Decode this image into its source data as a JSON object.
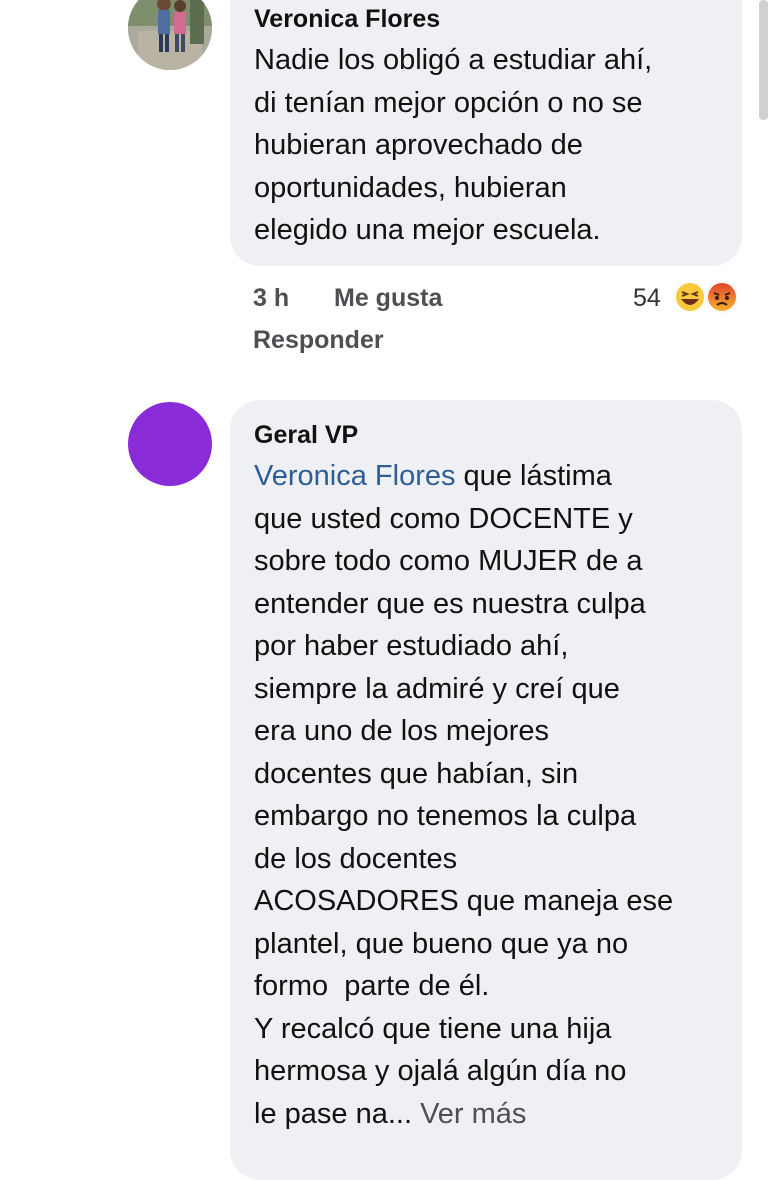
{
  "comments": [
    {
      "author": "Veronica Flores",
      "lines": [
        "Nadie los obligó a estudiar ahí,",
        "di tenían mejor opción o no se",
        "hubieran aprovechado de",
        "oportunidades, hubieran",
        "elegido una mejor escuela."
      ],
      "time": "3 h",
      "like_label": "Me gusta",
      "reply_label": "Responder",
      "reaction_count": "54",
      "reactions": [
        "haha-icon",
        "angry-icon"
      ]
    },
    {
      "author": "Geral VP",
      "mention": "Veronica Flores",
      "first_line_rest": " que lástima",
      "lines": [
        "que usted como DOCENTE y",
        "sobre todo como MUJER de a",
        "entender que es nuestra culpa",
        "por haber estudiado ahí,",
        "siempre la admiré y creí que",
        "era uno de los mejores",
        "docentes que habían, sin",
        "embargo no tenemos la culpa",
        "de los docentes",
        "ACOSADORES que maneja ese",
        "plantel, que bueno que ya no",
        "formo  parte de él.",
        "Y recalcó que tiene una hija",
        "hermosa y ojalá algún día no"
      ],
      "truncated_line": "le pase na...",
      "see_more_label": "Ver más"
    }
  ],
  "colors": {
    "bubble": "#eff0f3",
    "mention": "#2f5d96",
    "avatar_purple": "#8a2bd8"
  }
}
